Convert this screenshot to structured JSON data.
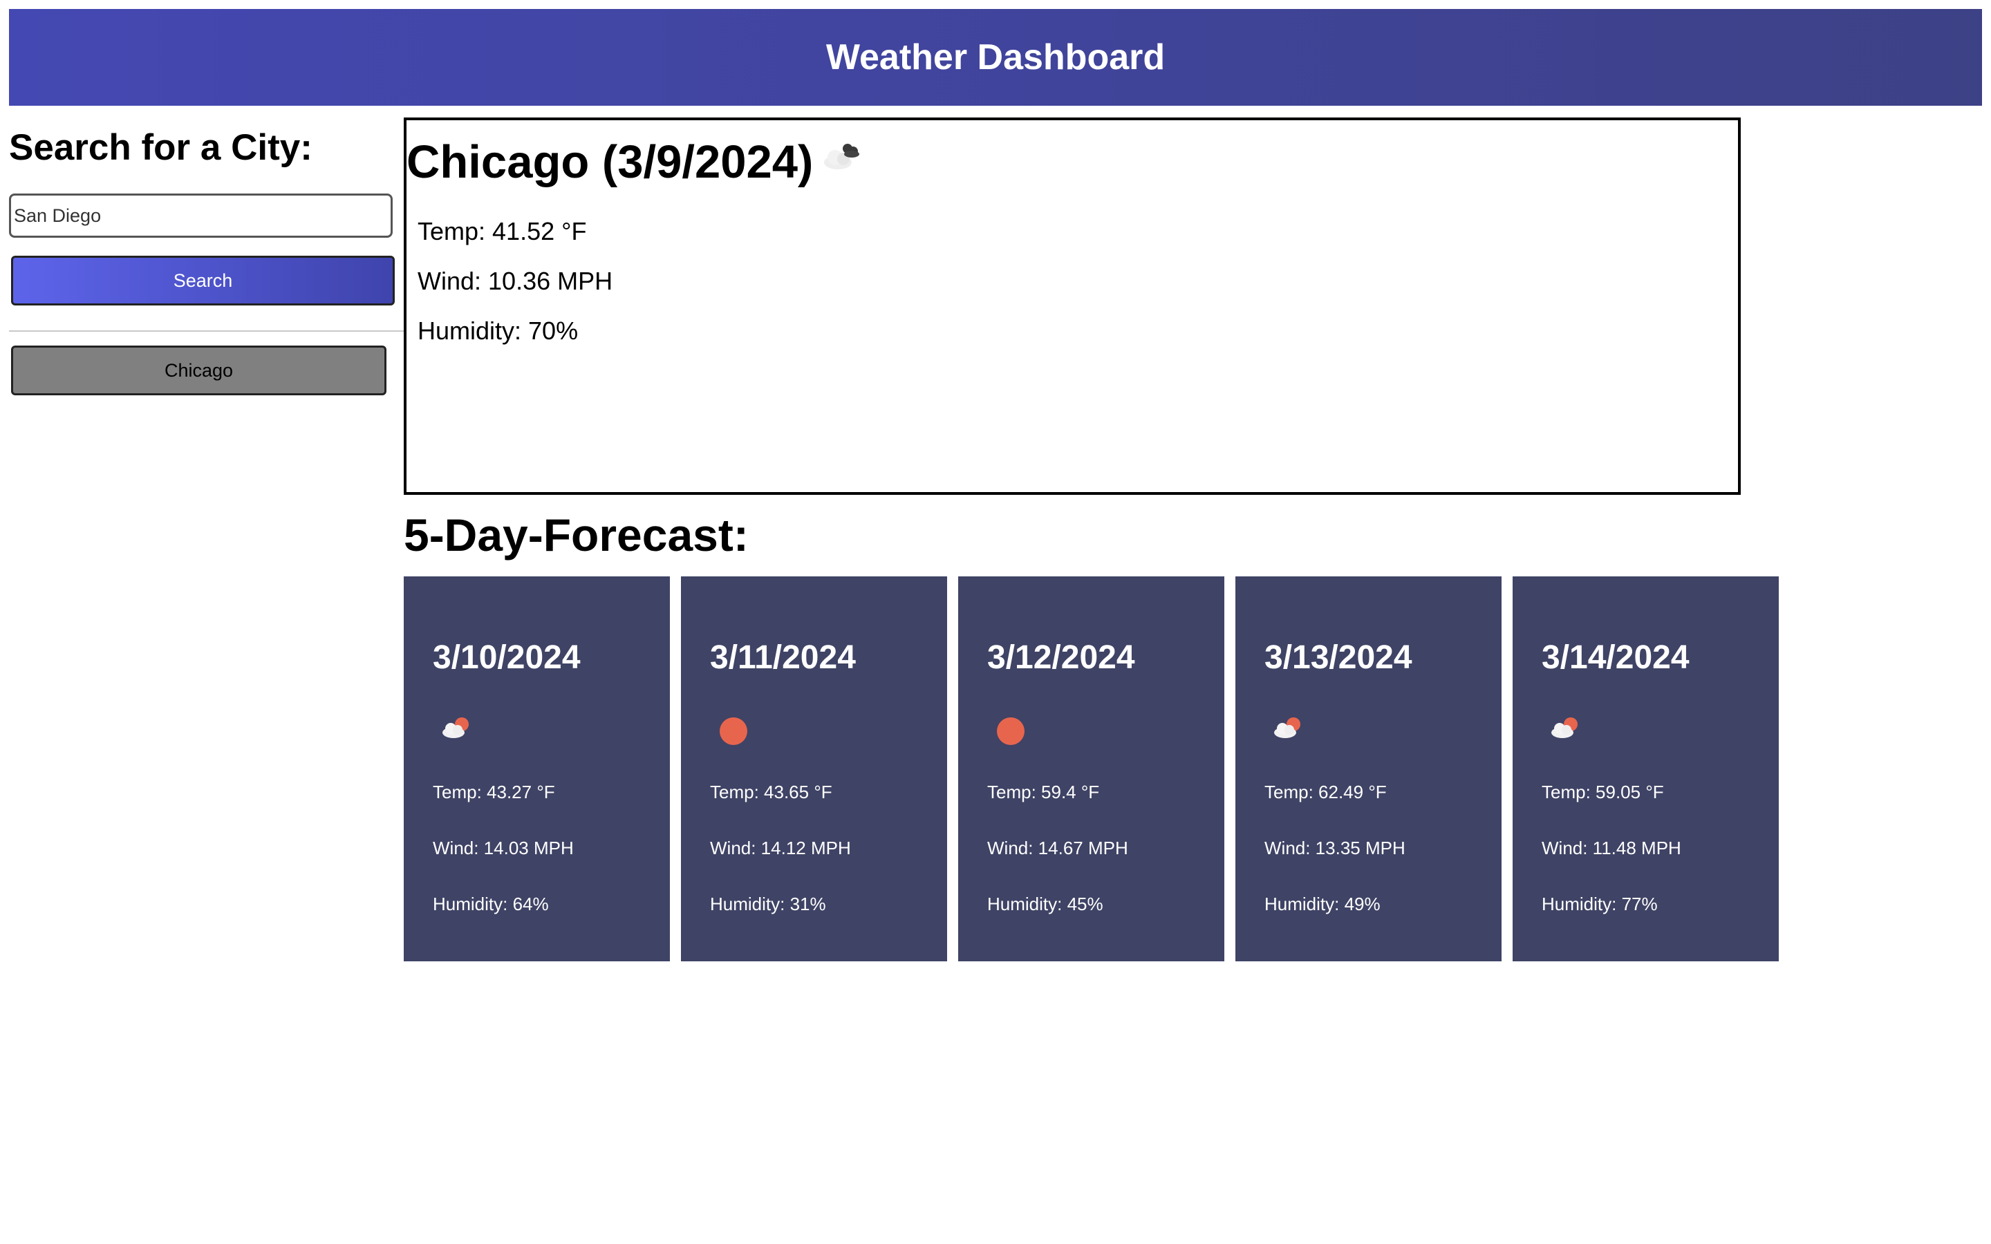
{
  "header": {
    "title": "Weather Dashboard"
  },
  "sidebar": {
    "heading": "Search for a City:",
    "search_value": "San Diego",
    "search_button": "Search",
    "history": [
      "Chicago"
    ]
  },
  "current": {
    "title": "Chicago (3/9/2024)",
    "icon": "broken-clouds-icon",
    "temp": "Temp: 41.52 °F",
    "wind": "Wind: 10.36 MPH",
    "humidity": "Humidity: 70%"
  },
  "forecast": {
    "heading": "5-Day-Forecast:",
    "days": [
      {
        "date": "3/10/2024",
        "icon": "few-clouds-icon",
        "temp": "Temp: 43.27 °F",
        "wind": "Wind: 14.03 MPH",
        "humidity": "Humidity: 64%"
      },
      {
        "date": "3/11/2024",
        "icon": "clear-sky-icon",
        "temp": "Temp: 43.65 °F",
        "wind": "Wind: 14.12 MPH",
        "humidity": "Humidity: 31%"
      },
      {
        "date": "3/12/2024",
        "icon": "clear-sky-icon",
        "temp": "Temp: 59.4 °F",
        "wind": "Wind: 14.67 MPH",
        "humidity": "Humidity: 45%"
      },
      {
        "date": "3/13/2024",
        "icon": "few-clouds-icon",
        "temp": "Temp: 62.49 °F",
        "wind": "Wind: 13.35 MPH",
        "humidity": "Humidity: 49%"
      },
      {
        "date": "3/14/2024",
        "icon": "few-clouds-icon",
        "temp": "Temp: 59.05 °F",
        "wind": "Wind: 11.48 MPH",
        "humidity": "Humidity: 77%"
      }
    ]
  },
  "colors": {
    "header_gradient_start": "#4448b2",
    "header_gradient_end": "#3d4186",
    "card_background": "#3f4365",
    "sun": "#e8654d"
  }
}
